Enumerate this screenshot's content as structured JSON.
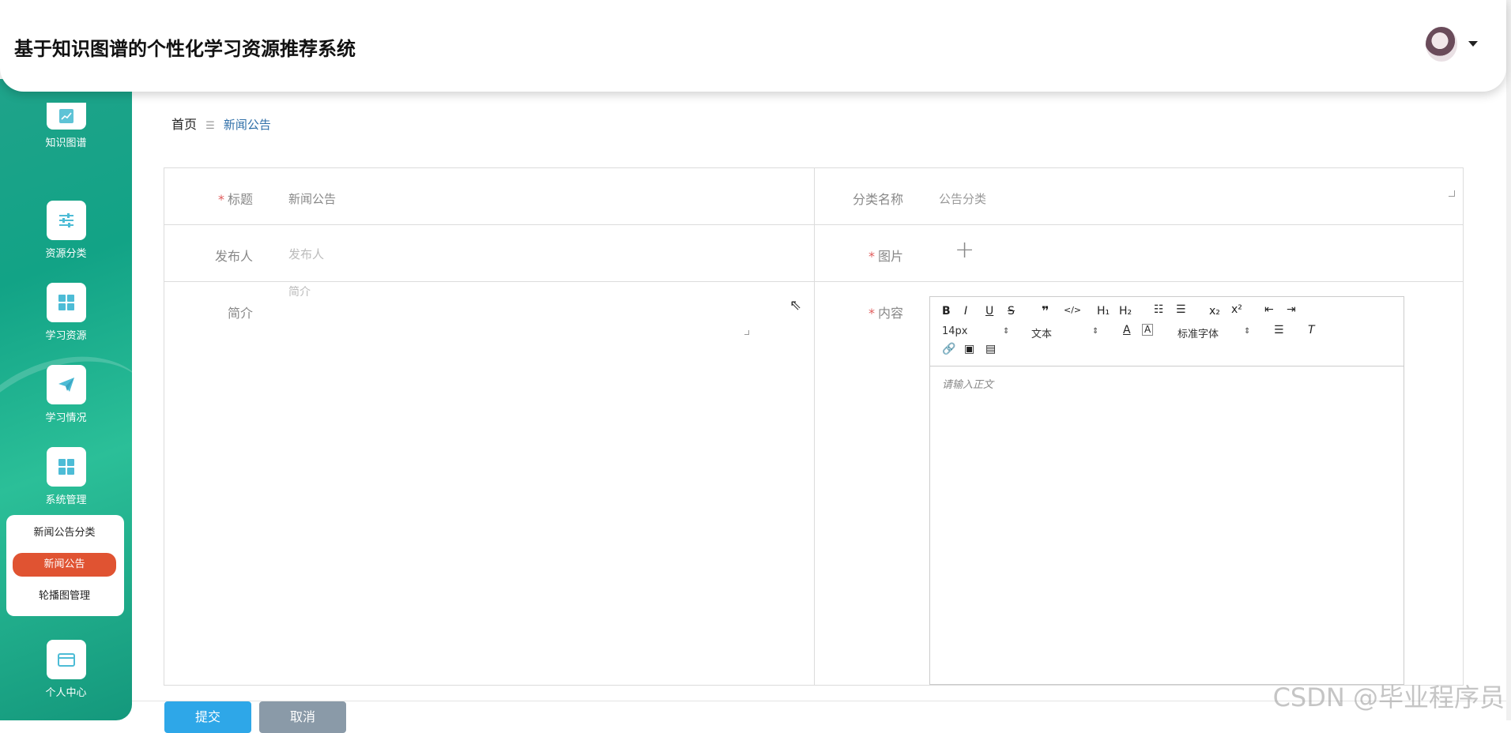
{
  "app": {
    "title": "基于知识图谱的个性化学习资源推荐系统"
  },
  "sidebar": {
    "items": [
      {
        "label": "知识图谱",
        "icon": "chart-line-icon"
      },
      {
        "label": "资源分类",
        "icon": "sliders-icon"
      },
      {
        "label": "学习资源",
        "icon": "grid-icon"
      },
      {
        "label": "学习情况",
        "icon": "paper-plane-icon"
      },
      {
        "label": "系统管理",
        "icon": "grid-icon"
      },
      {
        "label": "个人中心",
        "icon": "wallet-icon"
      }
    ],
    "submenu": [
      {
        "label": "新闻公告分类"
      },
      {
        "label": "新闻公告",
        "active": true
      },
      {
        "label": "轮播图管理"
      }
    ],
    "accent": "#1fa38a",
    "active_color": "#e05332"
  },
  "breadcrumb": {
    "home": "首页",
    "separator": "☰",
    "current": "新闻公告"
  },
  "form": {
    "title_label": "标题",
    "title_value": "新闻公告",
    "category_label": "分类名称",
    "category_value": "公告分类",
    "publisher_label": "发布人",
    "publisher_placeholder": "发布人",
    "image_label": "图片",
    "intro_label": "简介",
    "intro_placeholder": "简介",
    "content_label": "内容",
    "required_mark": "*"
  },
  "editor": {
    "font_size": "14px",
    "text_style": "文本",
    "font_family": "标准字体",
    "placeholder": "请输入正文"
  },
  "actions": {
    "submit": "提交",
    "cancel": "取消"
  },
  "watermark": "CSDN @毕业程序员"
}
